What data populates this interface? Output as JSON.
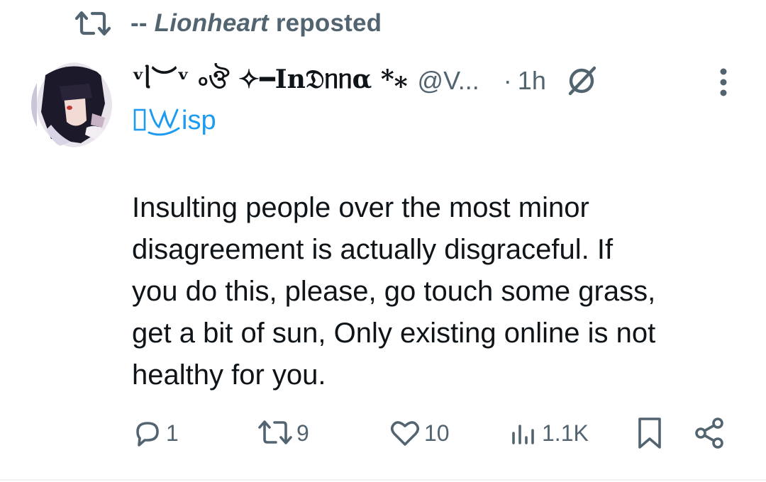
{
  "repost": {
    "icon": "repost-icon",
    "prefix": "-- ",
    "name": "Lionheart",
    "suffix": " reposted"
  },
  "tweet": {
    "display_name": "ᵛᥣ︶ᵛ ৹ঔ ✧━In𝔇ᥒᥒα *⁎",
    "handle": "@V...",
    "dot": "·",
    "time": "1h",
    "affiliation_label": "isp",
    "text": "Insulting people over the most minor\ndisagreement is actually disgraceful. If\nyou do this, please, go touch some grass,\nget a bit of sun, Only existing online is not\nhealthy for you."
  },
  "actions": {
    "replies": "1",
    "reposts": "9",
    "likes": "10",
    "views": "1.1K"
  },
  "colors": {
    "text": "#0f1419",
    "secondary": "#536471",
    "accent": "#1d9bf0"
  }
}
